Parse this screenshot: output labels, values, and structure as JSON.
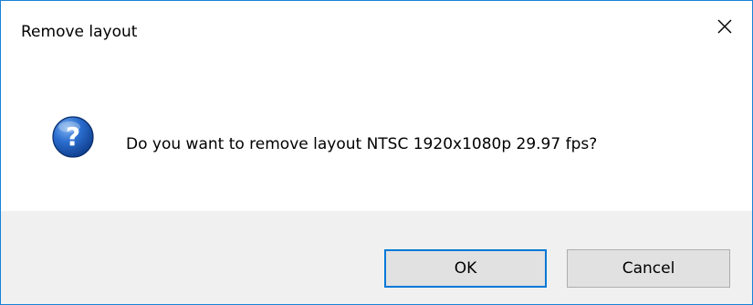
{
  "dialog": {
    "title": "Remove layout",
    "message": "Do you want to remove layout NTSC 1920x1080p 29.97 fps?",
    "icon": "question-icon",
    "buttons": {
      "ok_label": "OK",
      "cancel_label": "Cancel"
    },
    "close_icon": "close-icon"
  },
  "colors": {
    "window_border": "#1883d7",
    "footer_background": "#f0f0f0",
    "button_background": "#e1e1e1",
    "default_button_border": "#0078d7",
    "icon_blue": "#1a5fb4"
  }
}
